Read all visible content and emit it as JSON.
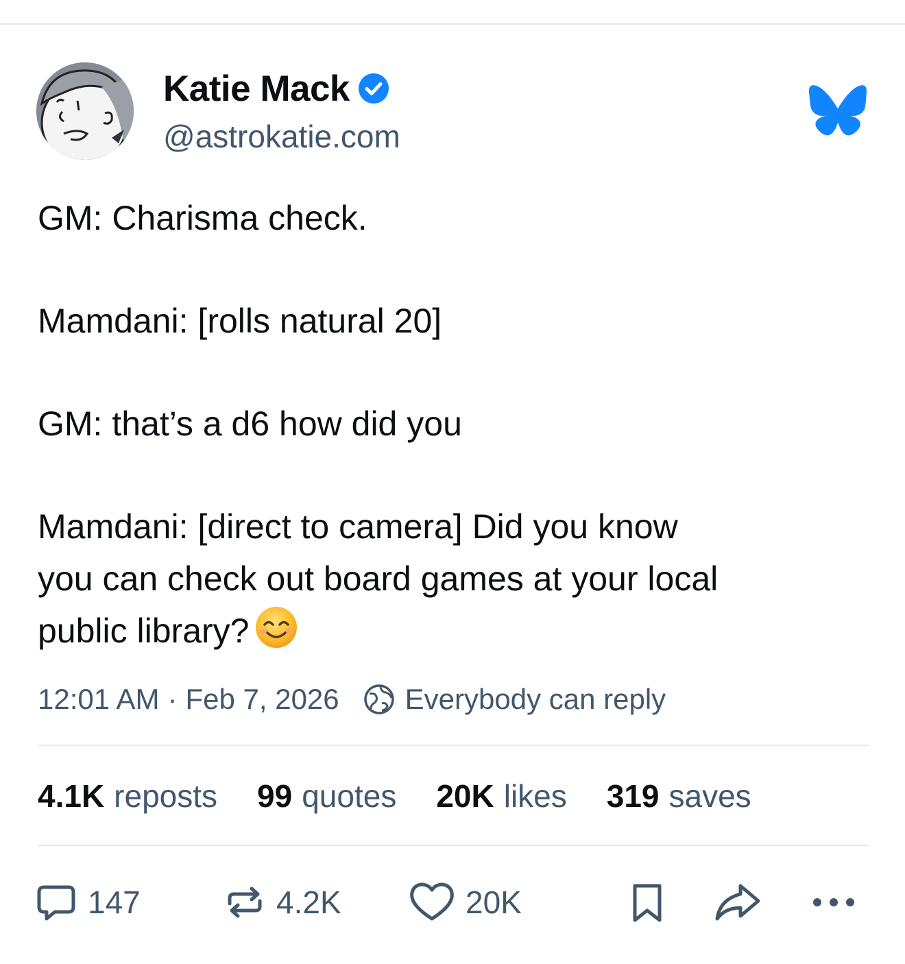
{
  "author": {
    "display_name": "Katie Mack",
    "handle": "@astrokatie.com",
    "verified": true
  },
  "post": {
    "paragraphs": [
      "GM: Charisma check.",
      "Mamdani: [rolls natural 20]",
      "GM: that’s a d6 how did you"
    ],
    "last_paragraph_lines": [
      "Mamdani: [direct to camera] Did you know",
      "you can check out board games at your local",
      "public library?"
    ],
    "emoji": "smiling-face-with-smiling-eyes"
  },
  "meta": {
    "time": "12:01 AM",
    "separator": "·",
    "date": "Feb 7, 2026",
    "reply_permission": "Everybody can reply"
  },
  "stats": {
    "reposts": {
      "count": "4.1K",
      "label": "reposts"
    },
    "quotes": {
      "count": "99",
      "label": "quotes"
    },
    "likes": {
      "count": "20K",
      "label": "likes"
    },
    "saves": {
      "count": "319",
      "label": "saves"
    }
  },
  "actions": {
    "reply_count": "147",
    "repost_count": "4.2K",
    "like_count": "20K"
  },
  "colors": {
    "bluesky_brand": "#1185fe",
    "verified_badge": "#1185fe",
    "text_primary": "#0b0f14",
    "text_secondary": "#42576c"
  },
  "icons": {
    "platform": "bluesky-butterfly-icon",
    "verified": "verified-check-icon",
    "reply_permission": "globe-icon",
    "reply": "reply-bubble-icon",
    "repost": "repost-icon",
    "like": "heart-icon",
    "save": "bookmark-icon",
    "share": "share-arrow-icon",
    "more": "more-dots-icon"
  }
}
